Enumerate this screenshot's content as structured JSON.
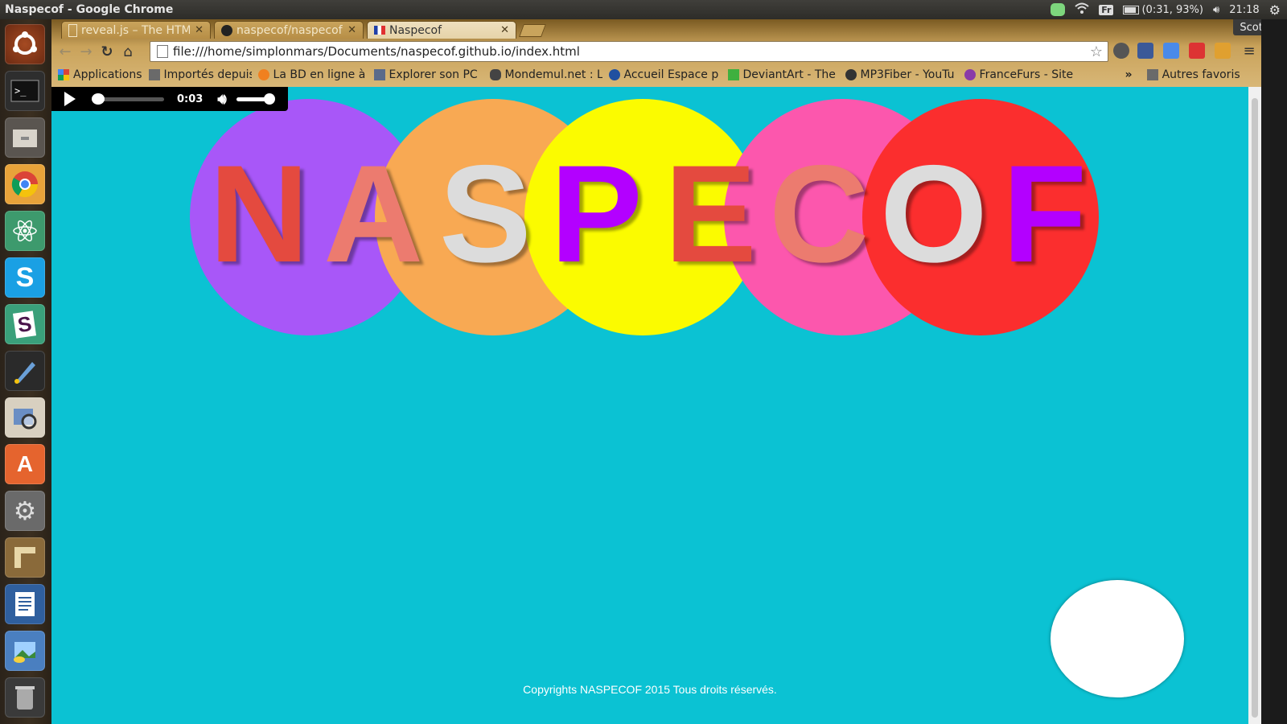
{
  "os_panel": {
    "window_title": "Naspecof - Google Chrome",
    "keyboard_layout": "Fr",
    "battery": "(0:31, 93%)",
    "clock": "21:18"
  },
  "launcher": {
    "items": [
      "ubuntu-dash",
      "terminal",
      "files",
      "chrome",
      "atom",
      "skype",
      "slack",
      "inkscape",
      "image-viewer",
      "software-center",
      "system-settings",
      "libreoffice-impress",
      "libreoffice-writer",
      "image-editor",
      "trash"
    ]
  },
  "browser": {
    "profile_name": "Scotflo",
    "tabs": [
      {
        "label": "reveal.js – The HTML",
        "active": false
      },
      {
        "label": "naspecof/naspecof",
        "active": false
      },
      {
        "label": "Naspecof",
        "active": true
      }
    ],
    "url": "file:///home/simplonmars/Documents/naspecof.github.io/index.html",
    "bookmarks": [
      "Applications",
      "Importés depuis",
      "La BD en ligne à",
      "Explorer son PC",
      "Mondemul.net : L",
      "Accueil Espace p",
      "DeviantArt - The",
      "MP3Fiber - YouTu",
      "FranceFurs - Site"
    ],
    "bookmarks_overflow": "»",
    "other_bookmarks": "Autres favoris"
  },
  "page": {
    "player": {
      "time": "0:03"
    },
    "logo": {
      "letters": [
        "N",
        "A",
        "S",
        "P",
        "E",
        "C",
        "O",
        "F"
      ],
      "colors": {
        "background": "#0bc2d3",
        "circles": [
          "#a857f8",
          "#f8a953",
          "#fbfb00",
          "#fc57ad",
          "#fb2e2e"
        ],
        "letters": [
          "#e44a3f",
          "#ec7b6f",
          "#dcdcdc",
          "#b300ff",
          "#e44a3f",
          "#ec7b6f",
          "#dcdcdc",
          "#b300ff"
        ]
      }
    },
    "footer_text": "Copyrights NASPECOF 2015 Tous droits réservés."
  }
}
